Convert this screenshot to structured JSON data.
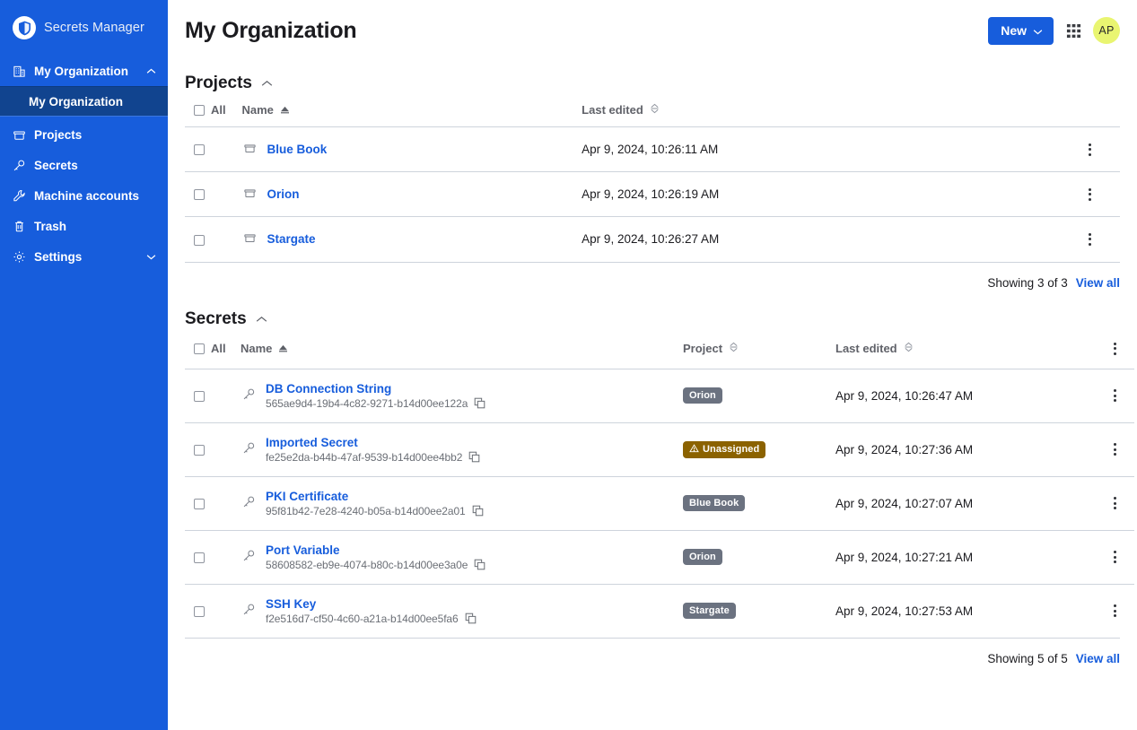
{
  "sidebar": {
    "brand": {
      "name": "Secrets Manager",
      "logo_icon": "bitwarden-shield-icon"
    },
    "items": [
      {
        "label": "My Organization",
        "icon": "organization-icon",
        "chevron": "chevron-up-icon",
        "expanded": true
      },
      {
        "label": "Projects",
        "icon": "projects-folder-icon"
      },
      {
        "label": "Secrets",
        "icon": "key-icon"
      },
      {
        "label": "Machine accounts",
        "icon": "wrench-icon"
      },
      {
        "label": "Trash",
        "icon": "trash-icon"
      },
      {
        "label": "Settings",
        "icon": "gear-icon",
        "chevron": "chevron-down-icon"
      }
    ],
    "sub_item": {
      "label": "My Organization",
      "active": true
    }
  },
  "header": {
    "title": "My Organization",
    "new_button": {
      "label": "New",
      "icon": "chevron-down-icon"
    },
    "grid_icon": "apps-grid-icon",
    "avatar": {
      "initials": "AP",
      "color": "#e9f571"
    }
  },
  "projects_section": {
    "title": "Projects",
    "collapse_icon": "chevron-up-icon",
    "columns": {
      "all": "All",
      "name": "Name",
      "name_sort": "sort-ascending-icon",
      "last_edited": "Last edited",
      "last_edited_sort": "sort-none-icon"
    },
    "rows": [
      {
        "name": "Blue Book",
        "icon": "folder-icon",
        "last_edited": "Apr 9, 2024, 10:26:11 AM"
      },
      {
        "name": "Orion",
        "icon": "folder-icon",
        "last_edited": "Apr 9, 2024, 10:26:19 AM"
      },
      {
        "name": "Stargate",
        "icon": "folder-icon",
        "last_edited": "Apr 9, 2024, 10:26:27 AM"
      }
    ],
    "footer": {
      "showing": "Showing 3 of 3",
      "view_all": "View all"
    }
  },
  "secrets_section": {
    "title": "Secrets",
    "collapse_icon": "chevron-up-icon",
    "columns": {
      "all": "All",
      "name": "Name",
      "name_sort": "sort-ascending-icon",
      "project": "Project",
      "project_sort": "sort-none-icon",
      "last_edited": "Last edited",
      "last_edited_sort": "sort-none-icon"
    },
    "rows": [
      {
        "name": "DB Connection String",
        "icon": "key-icon",
        "uuid": "565ae9d4-19b4-4c82-9271-b14d00ee122a",
        "copy_icon": "copy-icon",
        "project": "Orion",
        "project_warning": false,
        "last_edited": "Apr 9, 2024, 10:26:47 AM"
      },
      {
        "name": "Imported Secret",
        "icon": "key-icon",
        "uuid": "fe25e2da-b44b-47af-9539-b14d00ee4bb2",
        "copy_icon": "copy-icon",
        "project": "Unassigned",
        "project_warning": true,
        "last_edited": "Apr 9, 2024, 10:27:36 AM"
      },
      {
        "name": "PKI Certificate",
        "icon": "key-icon",
        "uuid": "95f81b42-7e28-4240-b05a-b14d00ee2a01",
        "copy_icon": "copy-icon",
        "project": "Blue Book",
        "project_warning": false,
        "last_edited": "Apr 9, 2024, 10:27:07 AM"
      },
      {
        "name": "Port Variable",
        "icon": "key-icon",
        "uuid": "58608582-eb9e-4074-b80c-b14d00ee3a0e",
        "copy_icon": "copy-icon",
        "project": "Orion",
        "project_warning": false,
        "last_edited": "Apr 9, 2024, 10:27:21 AM"
      },
      {
        "name": "SSH Key",
        "icon": "key-icon",
        "uuid": "f2e516d7-cf50-4c60-a21a-b14d00ee5fa6",
        "copy_icon": "copy-icon",
        "project": "Stargate",
        "project_warning": false,
        "last_edited": "Apr 9, 2024, 10:27:53 AM"
      }
    ],
    "footer": {
      "showing": "Showing 5 of 5",
      "view_all": "View all"
    }
  },
  "colors": {
    "sidebar_bg": "#175ddc",
    "sidebar_active": "#11448f",
    "accent": "#175ddc",
    "badge": "#6b7280",
    "badge_warning": "#8b6200",
    "avatar": "#e9f571"
  }
}
